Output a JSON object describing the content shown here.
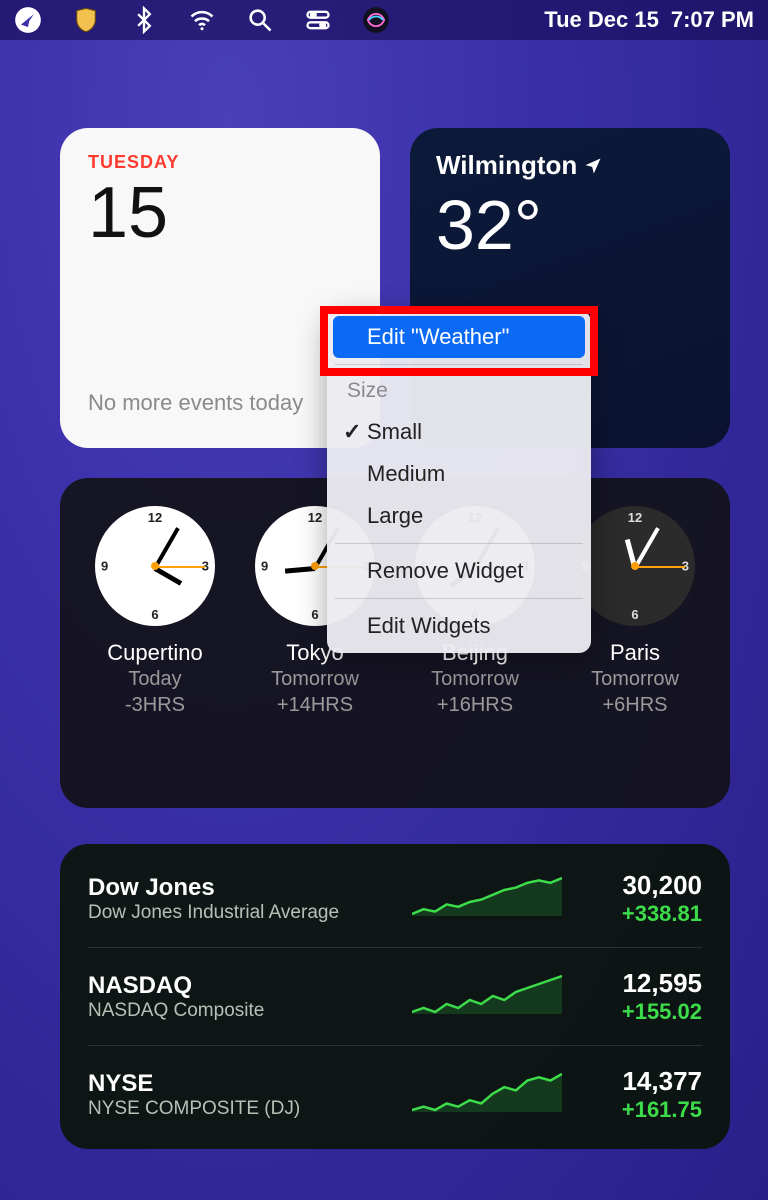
{
  "menubar": {
    "date": "Tue Dec 15",
    "time": "7:07 PM"
  },
  "calendar": {
    "day_label": "TUESDAY",
    "day_number": "15",
    "events": "No more events today"
  },
  "weather": {
    "city": "Wilmington",
    "temp": "32°"
  },
  "context_menu": {
    "edit": "Edit \"Weather\"",
    "size_label": "Size",
    "small": "Small",
    "medium": "Medium",
    "large": "Large",
    "remove": "Remove Widget",
    "edit_widgets": "Edit Widgets",
    "selected_size": "small"
  },
  "clocks": [
    {
      "city": "Cupertino",
      "meta1": "Today",
      "meta2": "-3HRS",
      "mode": "day",
      "hour_deg": 30,
      "min_deg": -60
    },
    {
      "city": "Tokyo",
      "meta1": "Tomorrow",
      "meta2": "+14HRS",
      "mode": "day",
      "hour_deg": 175,
      "min_deg": -60
    },
    {
      "city": "Beijing",
      "meta1": "Tomorrow",
      "meta2": "+16HRS",
      "mode": "day",
      "hour_deg": 145,
      "min_deg": -60
    },
    {
      "city": "Paris",
      "meta1": "Tomorrow",
      "meta2": "+6HRS",
      "mode": "night",
      "hour_deg": -105,
      "min_deg": -60
    }
  ],
  "stocks": [
    {
      "symbol": "Dow Jones",
      "desc": "Dow Jones Industrial Average",
      "price": "30,200",
      "change": "+338.81",
      "spark": [
        2,
        4,
        3,
        6,
        5,
        7,
        8,
        10,
        12,
        13,
        15,
        16,
        15,
        17
      ]
    },
    {
      "symbol": "NASDAQ",
      "desc": "NASDAQ Composite",
      "price": "12,595",
      "change": "+155.02",
      "spark": [
        4,
        5,
        4,
        6,
        5,
        7,
        6,
        8,
        7,
        9,
        10,
        11,
        12,
        13
      ]
    },
    {
      "symbol": "NYSE",
      "desc": "NYSE COMPOSITE (DJ)",
      "price": "14,377",
      "change": "+161.75",
      "spark": [
        3,
        4,
        3,
        5,
        4,
        6,
        5,
        8,
        10,
        9,
        12,
        13,
        12,
        14
      ]
    }
  ]
}
